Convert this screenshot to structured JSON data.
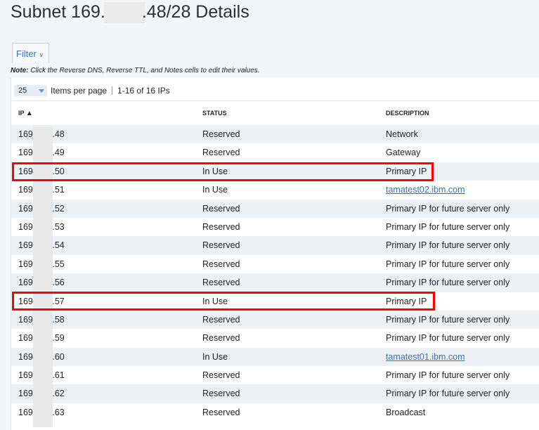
{
  "page": {
    "title_prefix": "Subnet 169.",
    "title_suffix": ".48/28 Details"
  },
  "filter": {
    "label": "Filter",
    "icon": "chevron-down-icon"
  },
  "note": {
    "bold": "Note:",
    "text": " Click the Reverse DNS, Reverse TTL, and Notes cells to edit their values."
  },
  "pager": {
    "per_page": "25",
    "per_page_label": "Items per page",
    "range": "1-16 of 16 IPs"
  },
  "columns": {
    "ip": "IP",
    "status": "STATUS",
    "description": "DESCRIPTION"
  },
  "rows": [
    {
      "ip_prefix": "169.",
      "ip_suffix": ".48",
      "status": "Reserved",
      "description": "Network"
    },
    {
      "ip_prefix": "169.",
      "ip_suffix": ".49",
      "status": "Reserved",
      "description": "Gateway"
    },
    {
      "ip_prefix": "169.",
      "ip_suffix": ".50",
      "status": "In Use",
      "description": "Primary IP"
    },
    {
      "ip_prefix": "169.",
      "ip_suffix": ".51",
      "status": "In Use",
      "description": "tamatest02.ibm.com",
      "link": true
    },
    {
      "ip_prefix": "169.",
      "ip_suffix": ".52",
      "status": "Reserved",
      "description": "Primary IP for future server only"
    },
    {
      "ip_prefix": "169.",
      "ip_suffix": ".53",
      "status": "Reserved",
      "description": "Primary IP for future server only"
    },
    {
      "ip_prefix": "169.",
      "ip_suffix": ".54",
      "status": "Reserved",
      "description": "Primary IP for future server only"
    },
    {
      "ip_prefix": "169.",
      "ip_suffix": ".55",
      "status": "Reserved",
      "description": "Primary IP for future server only"
    },
    {
      "ip_prefix": "169.",
      "ip_suffix": ".56",
      "status": "Reserved",
      "description": "Primary IP for future server only"
    },
    {
      "ip_prefix": "169.",
      "ip_suffix": ".57",
      "status": "In Use",
      "description": "Primary IP"
    },
    {
      "ip_prefix": "169.",
      "ip_suffix": ".58",
      "status": "Reserved",
      "description": "Primary IP for future server only"
    },
    {
      "ip_prefix": "169.",
      "ip_suffix": ".59",
      "status": "Reserved",
      "description": "Primary IP for future server only"
    },
    {
      "ip_prefix": "169.",
      "ip_suffix": ".60",
      "status": "In Use",
      "description": "tamatest01.ibm.com",
      "link": true
    },
    {
      "ip_prefix": "169.",
      "ip_suffix": ".61",
      "status": "Reserved",
      "description": "Primary IP for future server only"
    },
    {
      "ip_prefix": "169.",
      "ip_suffix": ".62",
      "status": "Reserved",
      "description": "Primary IP for future server only"
    },
    {
      "ip_prefix": "169.",
      "ip_suffix": ".63",
      "status": "Reserved",
      "description": "Broadcast"
    }
  ]
}
